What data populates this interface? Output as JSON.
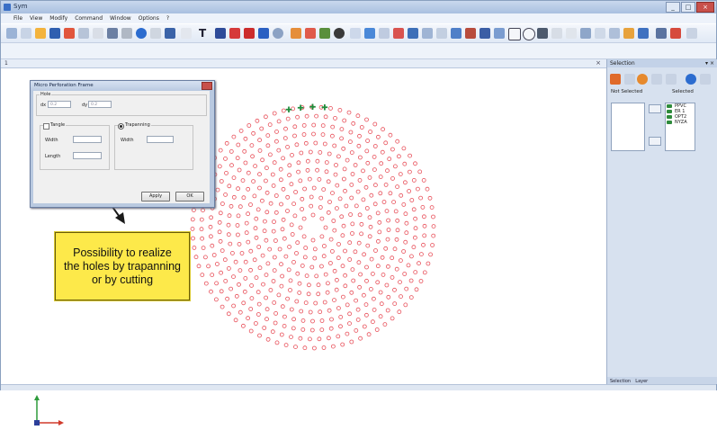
{
  "window": {
    "title": "Sym"
  },
  "menu": [
    "File",
    "View",
    "Modify",
    "Command",
    "Window",
    "Options",
    "?"
  ],
  "document_tab": {
    "label": "1"
  },
  "colors": {
    "hole_red": "#e8505a",
    "hole_green": "#1e8c3a",
    "callout_bg": "#fde94a",
    "arrow": "#1a1a1a"
  },
  "dialog": {
    "title": "Micro Perforation Frame",
    "group_label": "Hole",
    "x_label": "dx",
    "x_value": "0.2",
    "y_label": "dy",
    "y_value": "0.2",
    "tangle_label": "Tangle",
    "trapanning_label": "Trapanning",
    "tangle_fields": [
      {
        "label": "Width"
      },
      {
        "label": "Length"
      }
    ],
    "trap_fields": [
      {
        "label": "Width"
      }
    ],
    "apply_label": "Apply",
    "ok_label": "OK"
  },
  "callout": {
    "text": "Possibility to realize the holes by trapanning or by cutting"
  },
  "right_panel": {
    "title": "Selection",
    "not_selected_label": "Not Selected",
    "selected_label": "Selected",
    "selected_items": [
      "PPVC",
      "ER 1",
      "OPT2",
      "NYZA"
    ],
    "bottom_tabs": [
      "Selection",
      "Layer"
    ]
  },
  "pattern": {
    "ring_radii": [
      14,
      24,
      34,
      44,
      54,
      64,
      74,
      84,
      94,
      104,
      114,
      124,
      134
    ],
    "ring_counts": [
      8,
      14,
      20,
      26,
      32,
      38,
      44,
      50,
      56,
      62,
      68,
      74,
      80
    ],
    "hole_radius": 2
  }
}
